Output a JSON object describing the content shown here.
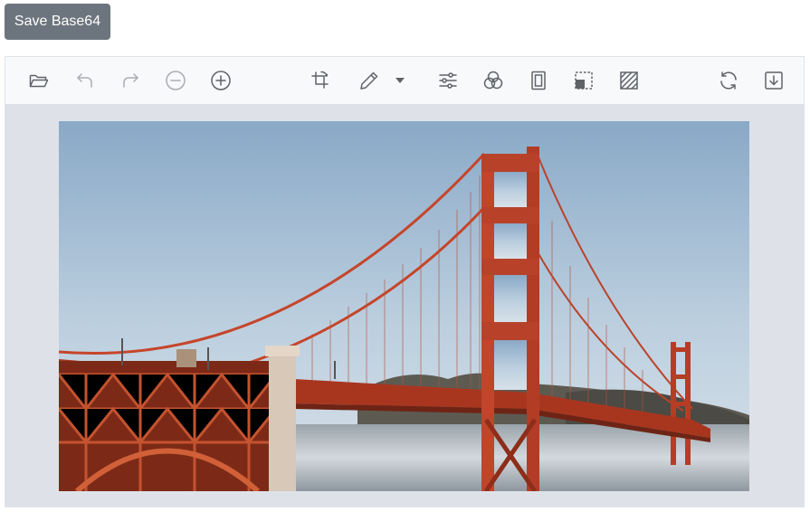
{
  "save_button": {
    "label": "Save Base64"
  },
  "toolbar": {
    "buttons": [
      {
        "name": "open-button",
        "icon": "folder-open-icon"
      },
      {
        "name": "undo-button",
        "icon": "undo-arrow-icon"
      },
      {
        "name": "redo-button",
        "icon": "redo-arrow-icon"
      },
      {
        "name": "zoom-out-button",
        "icon": "zoom-out-icon"
      },
      {
        "name": "zoom-in-button",
        "icon": "zoom-in-icon"
      },
      {
        "name": "crop-button",
        "icon": "crop-rotate-icon"
      },
      {
        "name": "annotate-button",
        "icon": "pencil-icon"
      },
      {
        "name": "annotate-dropdown-button",
        "icon": "caret-down-icon"
      },
      {
        "name": "adjust-button",
        "icon": "sliders-icon"
      },
      {
        "name": "filter-button",
        "icon": "filter-circles-icon"
      },
      {
        "name": "frame-button",
        "icon": "frame-icon"
      },
      {
        "name": "redact-button",
        "icon": "redact-icon"
      },
      {
        "name": "straighten-button",
        "icon": "hatch-icon"
      },
      {
        "name": "reset-button",
        "icon": "refresh-icon"
      },
      {
        "name": "save-image-button",
        "icon": "download-icon"
      }
    ]
  },
  "colors": {
    "accent_button": "#6c757d",
    "toolbar_bg": "#f8f9fa",
    "canvas_bg": "#dee2e8",
    "icon": "#5f6368",
    "icon_disabled": "#a9adb3"
  }
}
